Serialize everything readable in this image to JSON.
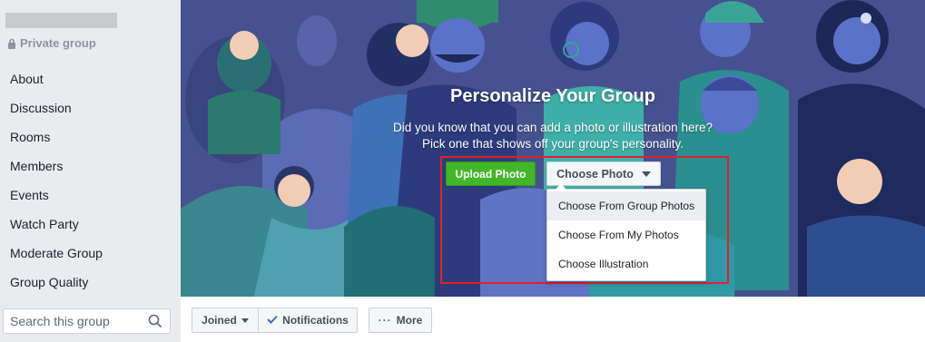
{
  "sidebar": {
    "privacy_label": "Private group",
    "items": [
      {
        "label": "About"
      },
      {
        "label": "Discussion"
      },
      {
        "label": "Rooms"
      },
      {
        "label": "Members"
      },
      {
        "label": "Events"
      },
      {
        "label": "Watch Party"
      },
      {
        "label": "Moderate Group"
      },
      {
        "label": "Group Quality"
      }
    ],
    "search": {
      "placeholder": "Search this group",
      "value": ""
    }
  },
  "cover": {
    "title": "Personalize Your Group",
    "text_line1": "Did you know that you can add a photo or illustration here?",
    "text_line2": "Pick one that shows off your group's personality.",
    "upload_label": "Upload Photo",
    "choose_label": "Choose Photo",
    "menu": [
      {
        "label": "Choose From Group Photos"
      },
      {
        "label": "Choose From My Photos"
      },
      {
        "label": "Choose Illustration"
      }
    ]
  },
  "actions": {
    "joined_label": "Joined",
    "notifications_label": "Notifications",
    "more_label": "More"
  },
  "colors": {
    "cover_bg": "#46528f",
    "upload_green": "#42b72a",
    "highlight_red": "#e0202f",
    "check_blue": "#4267b2"
  },
  "icons": [
    "lock-icon",
    "search-icon",
    "caret-down-icon",
    "check-icon",
    "dots-icon"
  ]
}
